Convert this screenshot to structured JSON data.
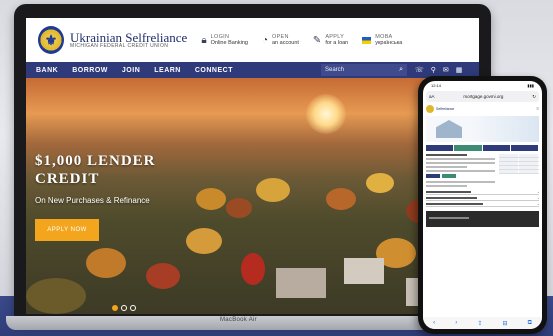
{
  "laptop": {
    "model": "MacBook Air"
  },
  "site": {
    "logo": {
      "title": "Ukrainian Selfreliance",
      "subtitle": "MICHIGAN FEDERAL CREDIT UNION",
      "emblem": "trident-icon"
    },
    "header_links": [
      {
        "line1": "LOGIN",
        "line2": "Online Banking",
        "icon": "lock-icon"
      },
      {
        "line1": "OPEN",
        "line2": "an account",
        "icon": "piggy-bank-icon"
      },
      {
        "line1": "APPLY",
        "line2": "for a loan",
        "icon": "pen-icon"
      },
      {
        "line1": "МОВА",
        "line2": "українська",
        "icon": "ukraine-flag-icon"
      }
    ],
    "nav": {
      "items": [
        "BANK",
        "BORROW",
        "JOIN",
        "LEARN",
        "CONNECT"
      ],
      "search_placeholder": "Search",
      "icons": [
        "phone-icon",
        "location-icon",
        "mail-icon",
        "calendar-icon"
      ]
    },
    "hero": {
      "title": "$1,000 LENDER\nCREDIT",
      "subtitle": "On New Purchases & Refinance",
      "button": "APPLY NOW",
      "slides": 3,
      "active_slide": 1
    }
  },
  "phone": {
    "time": "12:14",
    "url": "mortgage.govmi.org",
    "brand": "Selfreliance"
  },
  "colors": {
    "nav_blue": "#2e3a7a",
    "accent_orange": "#f3a51e",
    "band_blue": "#2f3d78"
  }
}
